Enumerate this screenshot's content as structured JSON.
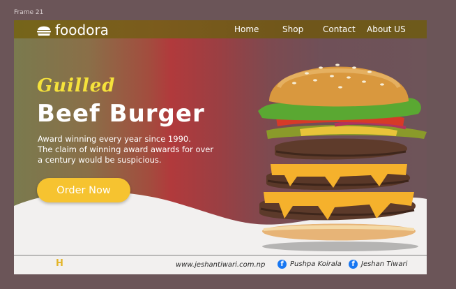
{
  "frame_label": "Frame 21",
  "brand": {
    "name": "foodora"
  },
  "nav": [
    {
      "label": "Home"
    },
    {
      "label": "Shop"
    },
    {
      "label": "Contact"
    },
    {
      "label": "About US"
    }
  ],
  "hero": {
    "subtitle": "Guilled",
    "title": "Beef Burger",
    "description_lines": [
      "Award winning every year since 1990.",
      "The claim of winning award awards for over",
      "a century would be suspicious."
    ],
    "cta_label": "Order Now"
  },
  "footer": {
    "logo_letter": "H",
    "website": "www.jeshantiwari.com.np",
    "social": [
      {
        "icon": "facebook-icon",
        "name": "Pushpa Koirala"
      },
      {
        "icon": "facebook-icon",
        "name": "Jeshan Tiwari"
      }
    ]
  },
  "colors": {
    "page_background": "#6b5558",
    "navbar": "#75601b",
    "accent_yellow": "#f6c330",
    "subtitle_yellow": "#f5e23b",
    "footer_background": "#f2f0ef",
    "facebook_blue": "#1877f2"
  }
}
